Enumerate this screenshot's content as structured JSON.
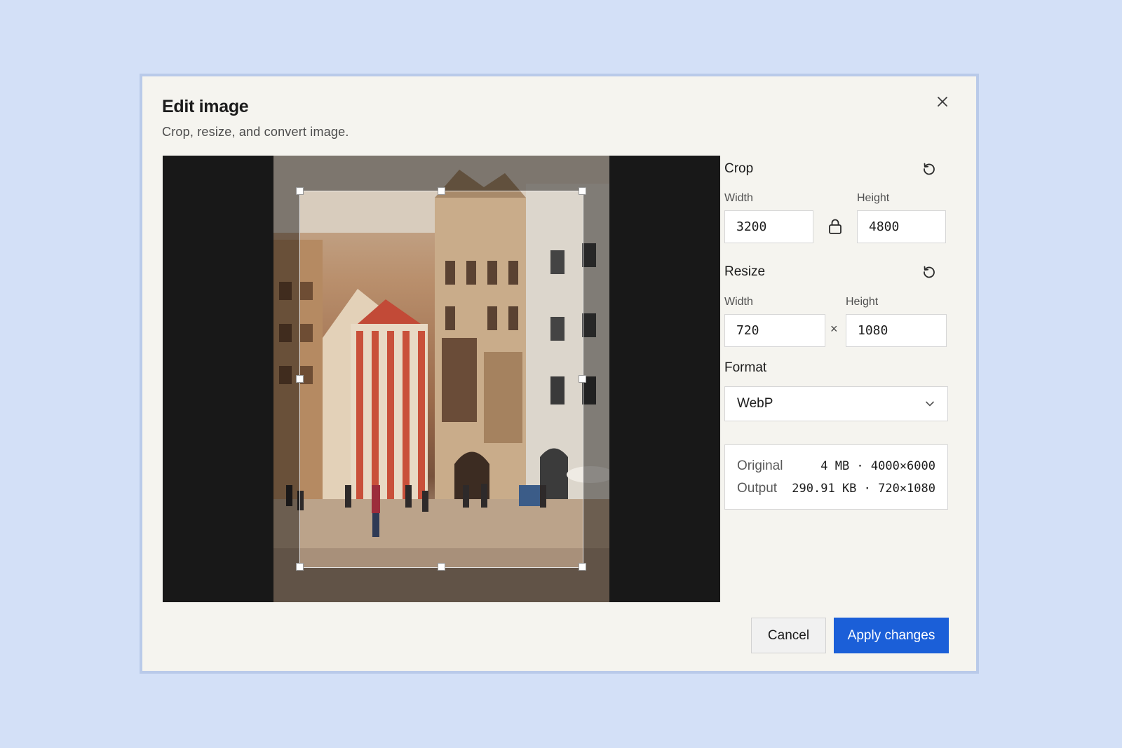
{
  "dialog": {
    "title": "Edit image",
    "subtitle": "Crop, resize, and convert image."
  },
  "crop": {
    "label": "Crop",
    "width_label": "Width",
    "height_label": "Height",
    "width": "3200",
    "height": "4800"
  },
  "resize": {
    "label": "Resize",
    "width_label": "Width",
    "height_label": "Height",
    "width": "720",
    "height": "1080",
    "separator": "×"
  },
  "format": {
    "label": "Format",
    "selected": "WebP"
  },
  "info": {
    "original_label": "Original",
    "original_value": "4 MB · 4000×6000",
    "output_label": "Output",
    "output_value": "290.91 KB · 720×1080"
  },
  "actions": {
    "cancel": "Cancel",
    "apply": "Apply changes"
  },
  "colors": {
    "page_background": "#d3e0f7",
    "dialog_background": "#f5f4ef",
    "primary": "#1b5fd8"
  },
  "icons": [
    "close-icon",
    "reset-icon",
    "lock-icon",
    "chevron-down-icon"
  ]
}
